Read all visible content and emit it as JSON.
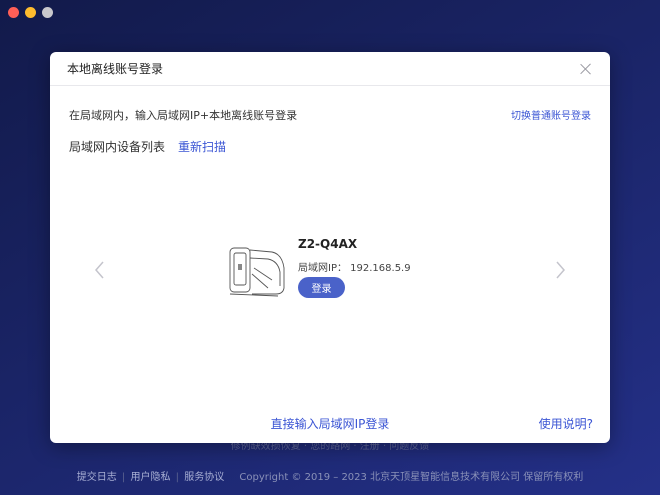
{
  "window": {
    "controls": [
      "close",
      "minimize",
      "disabled"
    ]
  },
  "background": {
    "hidden_row": "修例缺效损恢复 · 您的路网 · 注册 · 问题反馈",
    "footer": {
      "links": [
        "提交日志",
        "用户隐私",
        "服务协议"
      ],
      "separator": "|",
      "copyright": "Copyright © 2019 – 2023 北京天顶星智能信息技术有限公司 保留所有权利"
    }
  },
  "dialog": {
    "title": "本地离线账号登录",
    "instruction": "在局域网内，输入局域网IP+本地离线账号登录",
    "switch_link": "切换普通账号登录",
    "device_list_title": "局域网内设备列表",
    "rescan_link": "重新扫描",
    "device": {
      "name": "Z2-Q4AX",
      "ip_label": "局域网IP：",
      "ip_value": "192.168.5.9",
      "ip_text": "局域网IP：  192.168.5.9",
      "login_button": "登录",
      "image_icon": "nas-device-icon"
    },
    "direct_ip_link": "直接输入局域网IP登录",
    "help_link": "使用说明?"
  },
  "colors": {
    "accent": "#3b55d4",
    "button": "#4a62c9",
    "background_dark": "#121a4a"
  }
}
